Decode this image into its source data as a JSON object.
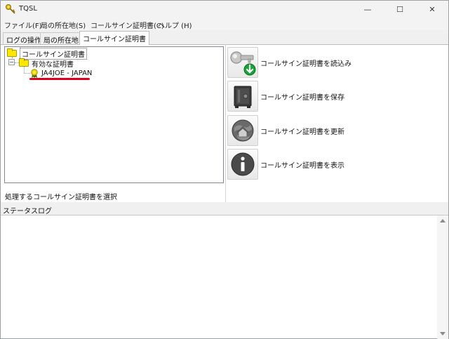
{
  "window": {
    "title": "TQSL"
  },
  "title_buttons": {
    "minimize": "—",
    "maximize": "☐",
    "close": "✕"
  },
  "menu": {
    "items": [
      {
        "label": "ファイル(F)"
      },
      {
        "label": "局の所在地(S)"
      },
      {
        "label": "コールサイン証明書(C)"
      },
      {
        "label": "ヘルプ (H)"
      }
    ]
  },
  "tabs": [
    {
      "label": "ログの操作"
    },
    {
      "label": "局の所在地"
    },
    {
      "label": "コールサイン証明書",
      "active": true
    }
  ],
  "tree": {
    "root": "コールサイン証明書",
    "group": "有効な証明書",
    "certificate": "JA4JOE - JAPAN",
    "expander": "−"
  },
  "prompt": "処理するコールサイン証明書を選択",
  "actions": [
    {
      "label": "コールサイン証明書を読込み",
      "icon": "key-download-icon"
    },
    {
      "label": "コールサイン証明書を保存",
      "icon": "safe-icon"
    },
    {
      "label": "コールサイン証明書を更新",
      "icon": "globe-renew-icon"
    },
    {
      "label": "コールサイン証明書を表示",
      "icon": "info-icon"
    }
  ],
  "status": {
    "label": "ステータスログ",
    "log": ""
  },
  "colors": {
    "highlight_underline": "#e0001a",
    "folder": "#ffe800",
    "download_arrow": "#1aa33a"
  }
}
